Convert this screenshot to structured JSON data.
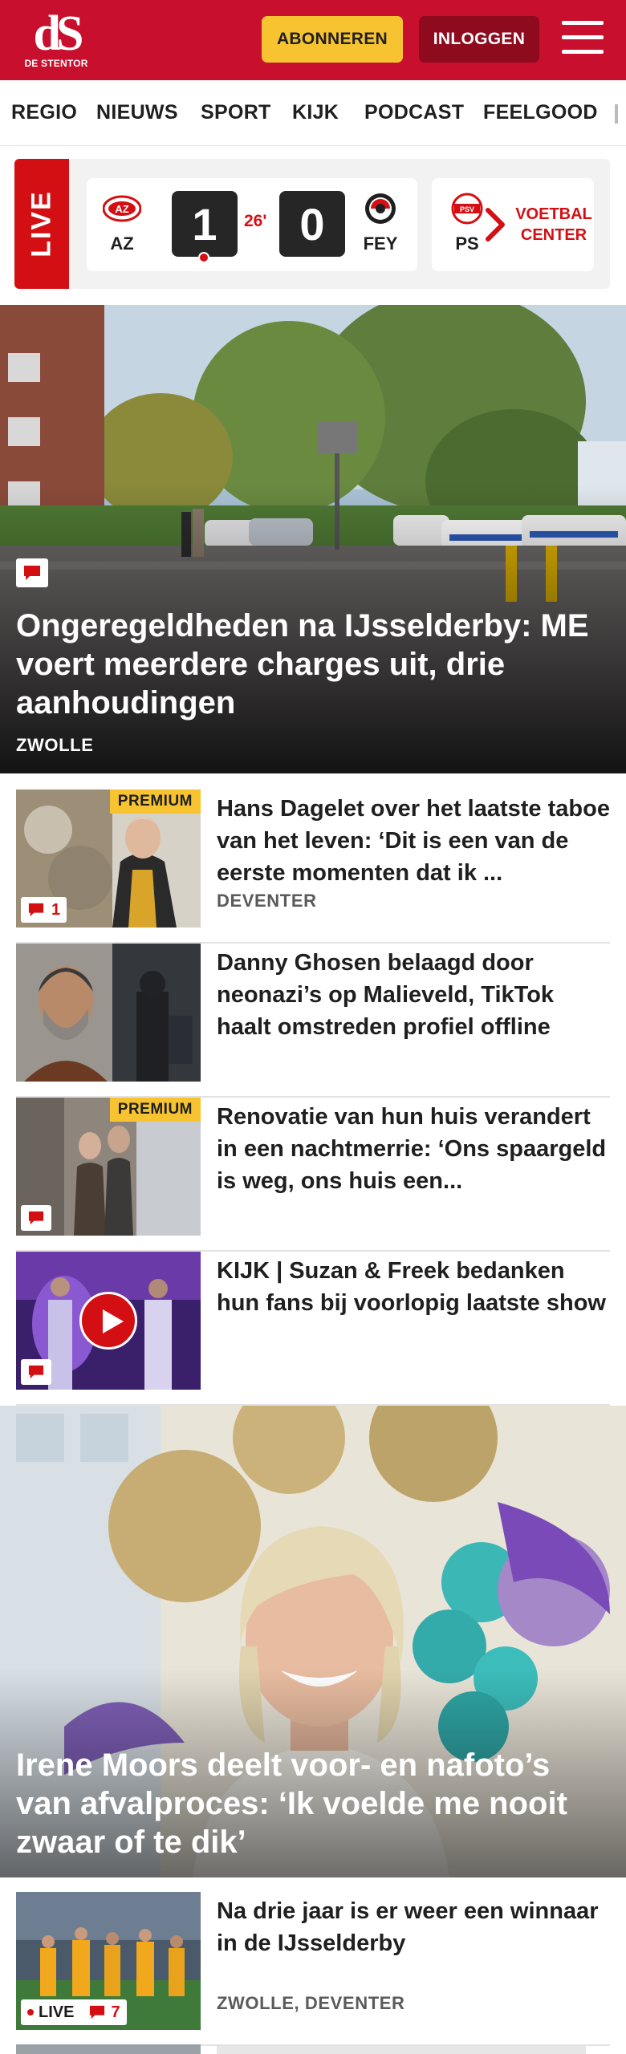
{
  "header": {
    "logo_mark": "dS",
    "logo_name": "DE STENTOR",
    "subscribe_label": "ABONNEREN",
    "login_label": "INLOGGEN"
  },
  "nav": {
    "items": [
      "REGIO",
      "NIEUWS",
      "SPORT",
      "KIJK",
      "PODCAST",
      "FEELGOOD"
    ]
  },
  "live": {
    "label": "LIVE",
    "match": {
      "home": "AZ",
      "away": "FEY",
      "home_score": "1",
      "away_score": "0",
      "minute": "26'"
    },
    "next_team": "PS",
    "voetbal_center_label": "VOETBAL CENTER"
  },
  "hero": {
    "title": "Ongeregeldheden na IJsselderby: ME voert meerdere charges uit, drie aanhoudingen",
    "tag": "ZWOLLE"
  },
  "articles": [
    {
      "title": "Hans Dagelet over het laatste taboe van het leven: ‘Dit is een van de eerste momenten dat ik ...",
      "tag": "DEVENTER",
      "premium": "PREMIUM",
      "comments": "1"
    },
    {
      "title": "Danny Ghosen belaagd door neonazi’s op Malieveld, TikTok haalt omstreden profiel offline",
      "tag": ""
    },
    {
      "title": "Renovatie van hun huis verandert in een nachtmerrie: ‘Ons spaargeld is weg, ons huis een...",
      "tag": "",
      "premium": "PREMIUM"
    },
    {
      "title": "KIJK | Suzan & Freek bedanken hun fans bij voorlopig laatste show",
      "tag": ""
    }
  ],
  "feature": {
    "title": "Irene Moors deelt voor- en nafoto’s van afvalproces: ‘Ik voelde me nooit zwaar of te dik’"
  },
  "last_article": {
    "title": "Na drie jaar is er weer een winnaar in de IJsselderby",
    "tag": "ZWOLLE, DEVENTER",
    "live_label": "LIVE",
    "comments": "7"
  },
  "colors": {
    "brand_red": "#c8102e",
    "subscribe_yellow": "#f7c331",
    "login_dark_red": "#8e0b1e"
  }
}
